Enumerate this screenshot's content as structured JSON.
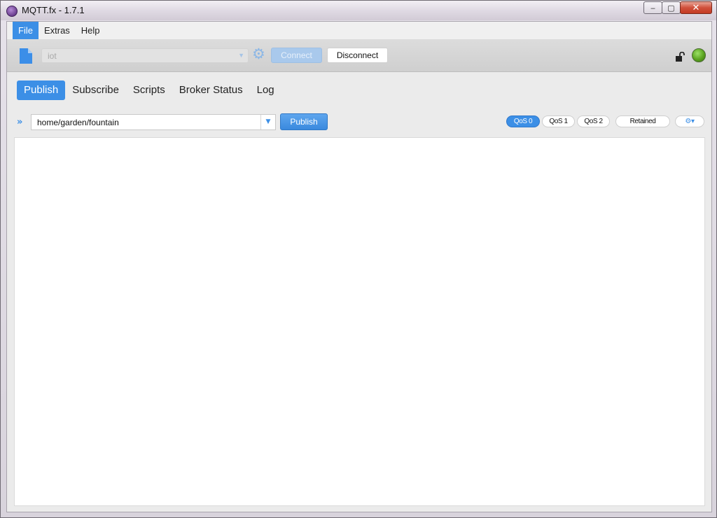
{
  "window": {
    "title": "MQTT.fx - 1.7.1",
    "app_icon": "mqtt-fx-logo",
    "minimize_label": "‒",
    "maximize_label": "▢",
    "close_label": "✕"
  },
  "menu": {
    "items": [
      {
        "label": "File",
        "active": true
      },
      {
        "label": "Extras",
        "active": false
      },
      {
        "label": "Help",
        "active": false
      }
    ]
  },
  "toolbar": {
    "file_icon": "new-file-icon",
    "profile_value": "iot",
    "profile_dropdown_arrow": "▼",
    "settings_icon": "gear-icon",
    "connect_label": "Connect",
    "disconnect_label": "Disconnect",
    "lock_icon": "unlocked-padlock-icon",
    "status_color": "#5aa31f"
  },
  "tabs": [
    {
      "label": "Publish",
      "active": true
    },
    {
      "label": "Subscribe",
      "active": false
    },
    {
      "label": "Scripts",
      "active": false
    },
    {
      "label": "Broker Status",
      "active": false
    },
    {
      "label": "Log",
      "active": false
    }
  ],
  "publish": {
    "expand_icon": "»",
    "topic_value": "home/garden/fountain",
    "topic_dropdown_arrow": "▼",
    "publish_label": "Publish",
    "qos": [
      {
        "label": "QoS 0",
        "active": true
      },
      {
        "label": "QoS 1",
        "active": false
      },
      {
        "label": "QoS 2",
        "active": false
      }
    ],
    "retained_label": "Retained",
    "options_icon": "⚙▾",
    "payload": ""
  },
  "colors": {
    "accent": "#3c8fe6"
  }
}
